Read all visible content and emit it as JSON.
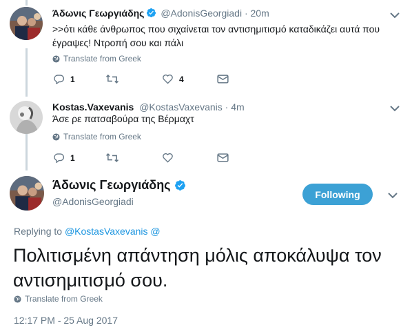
{
  "tweets": [
    {
      "display_name": "Άδωνις Γεωργιάδης",
      "handle": "@AdonisGeorgiadi",
      "time": "20m",
      "text": ">>ότι κάθε άνθρωπος που σιχαίνεται τον αντισημιτισμό καταδικάζει αυτά που έγραψες! Ντροπή σου και πάλι",
      "translate": "Translate from Greek",
      "replies": "1",
      "retweets": "",
      "likes": "4"
    },
    {
      "display_name": "Kostas.Vaxevanis",
      "handle": "@KostasVaxevanis",
      "time": "4m",
      "text": "Άσε ρε πατσαβούρα της Βέρμαχτ",
      "translate": "Translate from Greek",
      "replies": "1",
      "retweets": "",
      "likes": ""
    }
  ],
  "main": {
    "display_name": "Άδωνις Γεωργιάδης",
    "handle": "@AdonisGeorgiadi",
    "follow_label": "Following",
    "replying_prefix": "Replying to",
    "replying_to": "@KostasVaxevanis",
    "replying_suffix": "@",
    "text": "Πολιτισμένη απάντηση μόλις αποκάλυψα τον αντισημιτισμό σου.",
    "translate": "Translate from Greek",
    "timestamp": "12:17 PM - 25 Aug 2017"
  },
  "colors": {
    "accent": "#1da1f2",
    "follow_button": "#3ca1d5",
    "secondary_text": "#657786",
    "thread_line": "#ccd6dd"
  }
}
